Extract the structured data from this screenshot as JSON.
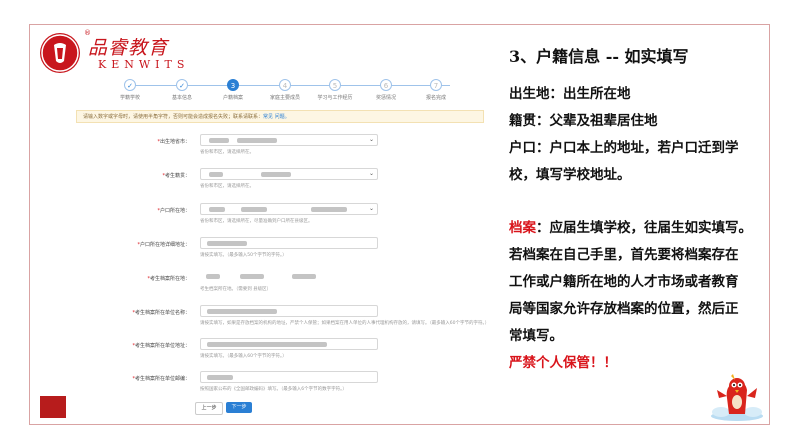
{
  "logo": {
    "cn": "品睿教育",
    "en": "KENWITS",
    "reg": "®"
  },
  "stepper": {
    "steps": [
      {
        "num": "✓",
        "label": "学籍学校"
      },
      {
        "num": "✓",
        "label": "基本信息"
      },
      {
        "num": "3",
        "label": "户籍档案"
      },
      {
        "num": "4",
        "label": "家庭主要成员"
      },
      {
        "num": "5",
        "label": "学习与工作经历"
      },
      {
        "num": "6",
        "label": "奖惩情况"
      },
      {
        "num": "7",
        "label": "报名完成"
      }
    ]
  },
  "notice": {
    "text": "请输入数字或字母时，请使用半角字符，否则可能会造成报名失败；联系请联系：",
    "link": "常见 问题。"
  },
  "form": {
    "fields": [
      {
        "label": "出生地省市：",
        "hint": "省份和市区，请选择所在。"
      },
      {
        "label": "考生籍贯：",
        "hint": "省份和市区，请选择所在。"
      },
      {
        "label": "户口所在地：",
        "hint": "省份和市区，请选择所在，尽量准确到户口所在县级区。"
      },
      {
        "label": "户口所在地详细地址：",
        "hint": "请按实填写。（最多输入50个字节的字符。）"
      },
      {
        "label": "考生档案所在地：",
        "hint": "考生档案所在地。（需要到 县级区）"
      },
      {
        "label": "考生档案所在单位名称：",
        "hint": "请按实填写，如果是存放档案的机构的地址，严禁个人保管；如果档案在用人单位的人事代理机构存放的，请填写。（最多输入60个字节的字符。）"
      },
      {
        "label": "考生档案所在单位地址：",
        "hint": "请按实填写。（最多输入60个字节的字符。）"
      },
      {
        "label": "考生档案所在单位邮编：",
        "hint": "按照国家公布的《全国邮政编码》填写。（最多输入6个字节的数字字符。）"
      }
    ],
    "prev_button": "上一步",
    "next_button": "下一步"
  },
  "right_panel": {
    "title": "3、户籍信息 -- 如实填写",
    "birthplace": "出生地：出生所在地",
    "native_place": "籍贯：父辈及祖辈居住地",
    "hukou_line1": "户口：户口本上的地址，若户口迁到学",
    "hukou_line2": "校，填写学校地址。",
    "archive_label": "档案",
    "archive_line1": "：应届生填学校，往届生如实填写。",
    "archive_line2": "若档案在自己手里，首先要将档案存在",
    "archive_line3": "工作或户籍所在地的人才市场或者教育",
    "archive_line4": "局等国家允许存放档案的位置，然后正",
    "archive_line5": "常填写。",
    "warning": "严禁个人保管！！"
  },
  "colors": {
    "brand_red": "#c8161d",
    "warning_red": "#d9141b",
    "primary_blue": "#2a7fd4"
  }
}
